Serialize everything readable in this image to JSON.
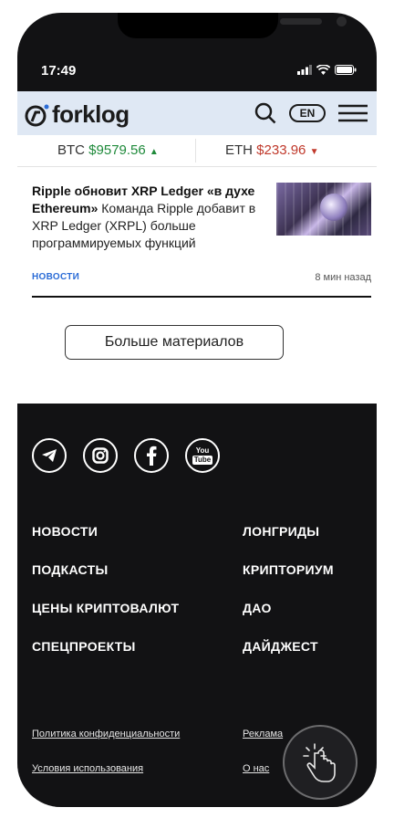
{
  "status_bar": {
    "time": "17:49"
  },
  "header": {
    "logo_text": "forklog",
    "lang_label": "EN",
    "icons": [
      "search-icon",
      "menu-icon"
    ]
  },
  "ticker": {
    "btc": {
      "label": "BTC",
      "price": "$9579.56",
      "arrow": "▲"
    },
    "eth": {
      "label": "ETH",
      "price": "$233.96",
      "arrow": "▼"
    },
    "colors": {
      "up": "#1f8a3b",
      "down": "#c0392b"
    }
  },
  "article": {
    "title": "Ripple обновит XRP Ledger «в духе Ethereum»",
    "snippet": " Команда Ripple добавит в XRP Ledger (XRPL) больше программируемых функций",
    "category": "НОВОСТИ",
    "time_ago": "8 мин назад"
  },
  "more_button": {
    "label": "Больше материалов"
  },
  "footer": {
    "socials": [
      "telegram-icon",
      "instagram-icon",
      "facebook-icon",
      "youtube-icon"
    ],
    "youtube_top": "You",
    "youtube_bottom": "Tube",
    "nav_left": [
      "НОВОСТИ",
      "ПОДКАСТЫ",
      "ЦЕНЫ КРИПТОВАЛЮТ",
      "СПЕЦПРОЕКТЫ"
    ],
    "nav_right": [
      "ЛОНГРИДЫ",
      "КРИПТОРИУМ",
      "ДАО",
      "ДАЙДЖЕСТ"
    ],
    "links_left": [
      "Политика конфиденциальности",
      "Условия использования"
    ],
    "links_right": [
      "Реклама",
      "О нас"
    ]
  },
  "accent_color": "#2b6cd6"
}
